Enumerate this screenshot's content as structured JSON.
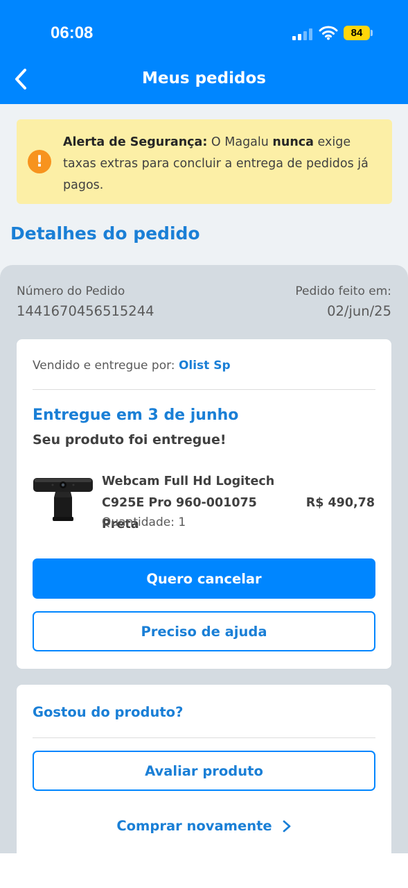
{
  "status_bar": {
    "time": "06:08",
    "battery": "84",
    "signal_icon": "cellular-signal-icon",
    "wifi_icon": "wifi-icon"
  },
  "header": {
    "title": "Meus pedidos",
    "back_icon": "chevron-left-icon"
  },
  "colors": {
    "brand_blue": "#0086ff",
    "link_blue": "#1a7fd6",
    "alert_bg": "#fcefa6",
    "alert_icon": "#f7931e"
  },
  "alert": {
    "icon": "exclamation-icon",
    "bold_prefix": "Alerta de Segurança:",
    "text_1": " O Magalu ",
    "bold_word": "nunca",
    "text_2": " exige taxas extras para concluir a entrega de pedidos já pagos."
  },
  "section_title": "Detalhes do pedido",
  "order": {
    "number_label": "Número do Pedido",
    "number": "1441670456515244",
    "date_label": "Pedido feito em:",
    "date": "02/jun/25"
  },
  "delivery_card": {
    "seller_label": "Vendido e entregue por: ",
    "seller_name": "Olist Sp",
    "status_title": "Entregue em 3 de junho",
    "status_sub": "Seu produto foi entregue!",
    "product": {
      "name": "Webcam Full Hd Logitech C925E Pro 960-001075 Preta",
      "price": "R$ 490,78",
      "quantity": "Quantidade: 1"
    },
    "cancel_button": "Quero cancelar",
    "help_button": "Preciso de ajuda"
  },
  "review_card": {
    "question": "Gostou do produto?",
    "rate_button": "Avaliar produto",
    "buy_again": "Comprar novamente"
  }
}
